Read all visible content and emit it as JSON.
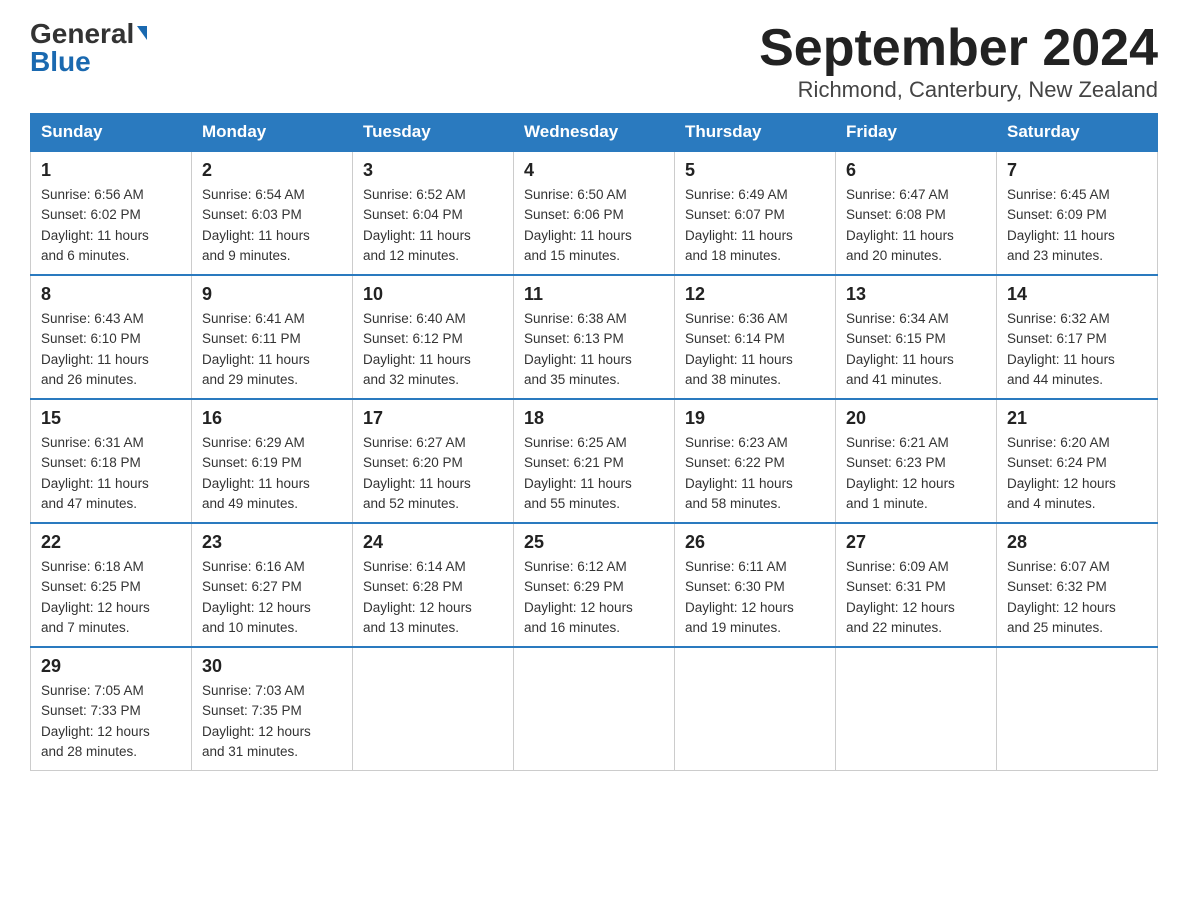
{
  "logo": {
    "general": "General",
    "triangle": "▲",
    "blue": "Blue"
  },
  "title": {
    "month_year": "September 2024",
    "location": "Richmond, Canterbury, New Zealand"
  },
  "headers": [
    "Sunday",
    "Monday",
    "Tuesday",
    "Wednesday",
    "Thursday",
    "Friday",
    "Saturday"
  ],
  "weeks": [
    [
      {
        "day": "1",
        "sunrise": "6:56 AM",
        "sunset": "6:02 PM",
        "daylight": "11 hours and 6 minutes."
      },
      {
        "day": "2",
        "sunrise": "6:54 AM",
        "sunset": "6:03 PM",
        "daylight": "11 hours and 9 minutes."
      },
      {
        "day": "3",
        "sunrise": "6:52 AM",
        "sunset": "6:04 PM",
        "daylight": "11 hours and 12 minutes."
      },
      {
        "day": "4",
        "sunrise": "6:50 AM",
        "sunset": "6:06 PM",
        "daylight": "11 hours and 15 minutes."
      },
      {
        "day": "5",
        "sunrise": "6:49 AM",
        "sunset": "6:07 PM",
        "daylight": "11 hours and 18 minutes."
      },
      {
        "day": "6",
        "sunrise": "6:47 AM",
        "sunset": "6:08 PM",
        "daylight": "11 hours and 20 minutes."
      },
      {
        "day": "7",
        "sunrise": "6:45 AM",
        "sunset": "6:09 PM",
        "daylight": "11 hours and 23 minutes."
      }
    ],
    [
      {
        "day": "8",
        "sunrise": "6:43 AM",
        "sunset": "6:10 PM",
        "daylight": "11 hours and 26 minutes."
      },
      {
        "day": "9",
        "sunrise": "6:41 AM",
        "sunset": "6:11 PM",
        "daylight": "11 hours and 29 minutes."
      },
      {
        "day": "10",
        "sunrise": "6:40 AM",
        "sunset": "6:12 PM",
        "daylight": "11 hours and 32 minutes."
      },
      {
        "day": "11",
        "sunrise": "6:38 AM",
        "sunset": "6:13 PM",
        "daylight": "11 hours and 35 minutes."
      },
      {
        "day": "12",
        "sunrise": "6:36 AM",
        "sunset": "6:14 PM",
        "daylight": "11 hours and 38 minutes."
      },
      {
        "day": "13",
        "sunrise": "6:34 AM",
        "sunset": "6:15 PM",
        "daylight": "11 hours and 41 minutes."
      },
      {
        "day": "14",
        "sunrise": "6:32 AM",
        "sunset": "6:17 PM",
        "daylight": "11 hours and 44 minutes."
      }
    ],
    [
      {
        "day": "15",
        "sunrise": "6:31 AM",
        "sunset": "6:18 PM",
        "daylight": "11 hours and 47 minutes."
      },
      {
        "day": "16",
        "sunrise": "6:29 AM",
        "sunset": "6:19 PM",
        "daylight": "11 hours and 49 minutes."
      },
      {
        "day": "17",
        "sunrise": "6:27 AM",
        "sunset": "6:20 PM",
        "daylight": "11 hours and 52 minutes."
      },
      {
        "day": "18",
        "sunrise": "6:25 AM",
        "sunset": "6:21 PM",
        "daylight": "11 hours and 55 minutes."
      },
      {
        "day": "19",
        "sunrise": "6:23 AM",
        "sunset": "6:22 PM",
        "daylight": "11 hours and 58 minutes."
      },
      {
        "day": "20",
        "sunrise": "6:21 AM",
        "sunset": "6:23 PM",
        "daylight": "12 hours and 1 minute."
      },
      {
        "day": "21",
        "sunrise": "6:20 AM",
        "sunset": "6:24 PM",
        "daylight": "12 hours and 4 minutes."
      }
    ],
    [
      {
        "day": "22",
        "sunrise": "6:18 AM",
        "sunset": "6:25 PM",
        "daylight": "12 hours and 7 minutes."
      },
      {
        "day": "23",
        "sunrise": "6:16 AM",
        "sunset": "6:27 PM",
        "daylight": "12 hours and 10 minutes."
      },
      {
        "day": "24",
        "sunrise": "6:14 AM",
        "sunset": "6:28 PM",
        "daylight": "12 hours and 13 minutes."
      },
      {
        "day": "25",
        "sunrise": "6:12 AM",
        "sunset": "6:29 PM",
        "daylight": "12 hours and 16 minutes."
      },
      {
        "day": "26",
        "sunrise": "6:11 AM",
        "sunset": "6:30 PM",
        "daylight": "12 hours and 19 minutes."
      },
      {
        "day": "27",
        "sunrise": "6:09 AM",
        "sunset": "6:31 PM",
        "daylight": "12 hours and 22 minutes."
      },
      {
        "day": "28",
        "sunrise": "6:07 AM",
        "sunset": "6:32 PM",
        "daylight": "12 hours and 25 minutes."
      }
    ],
    [
      {
        "day": "29",
        "sunrise": "7:05 AM",
        "sunset": "7:33 PM",
        "daylight": "12 hours and 28 minutes."
      },
      {
        "day": "30",
        "sunrise": "7:03 AM",
        "sunset": "7:35 PM",
        "daylight": "12 hours and 31 minutes."
      },
      null,
      null,
      null,
      null,
      null
    ]
  ],
  "labels": {
    "sunrise": "Sunrise: ",
    "sunset": "Sunset: ",
    "daylight": "Daylight: "
  }
}
